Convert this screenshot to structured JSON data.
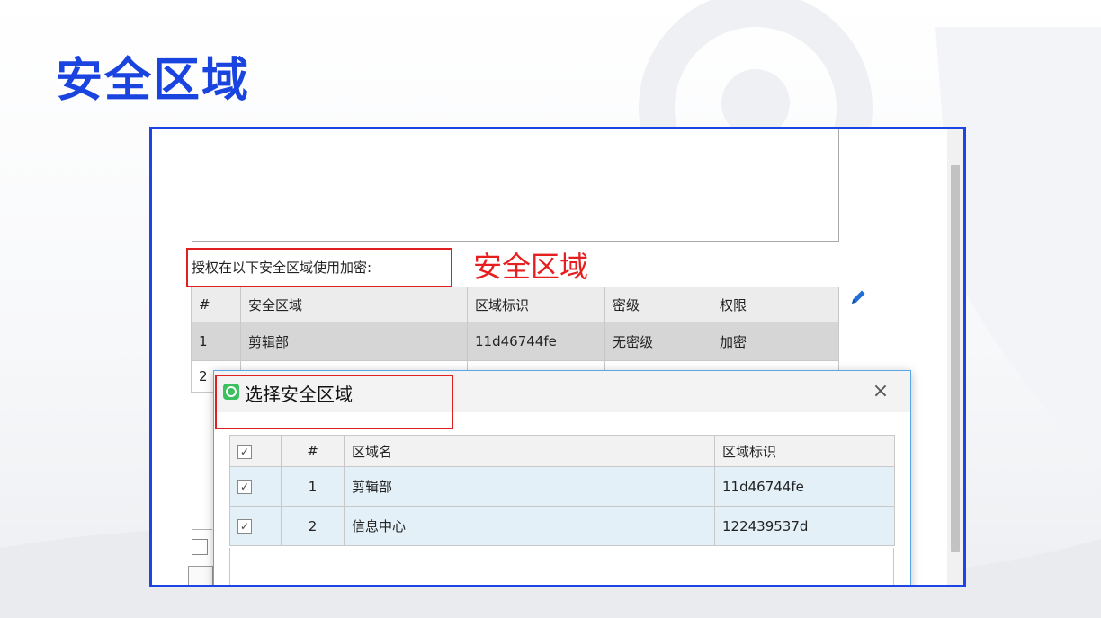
{
  "page": {
    "title": "安全区域"
  },
  "form": {
    "auth_label": "授权在以下安全区域使用加密:",
    "annotation": "安全区域",
    "columns": [
      "#",
      "安全区域",
      "区域标识",
      "密级",
      "权限"
    ],
    "rows": [
      {
        "num": "1",
        "zone": "剪辑部",
        "id": "11d46744fe",
        "level": "无密级",
        "perm": "加密"
      },
      {
        "num": "2"
      }
    ]
  },
  "dialog": {
    "title": "选择安全区域",
    "close": "×",
    "columns": [
      "✓",
      "#",
      "区域名",
      "区域标识"
    ],
    "rows": [
      {
        "check": "✓",
        "num": "1",
        "name": "剪辑部",
        "id": "11d46744fe"
      },
      {
        "check": "✓",
        "num": "2",
        "name": "信息中心",
        "id": "122439537d"
      }
    ]
  },
  "colors": {
    "title_blue": "#1a44e0",
    "frame_blue": "#1d45e6",
    "annotation_red": "#e61e1e",
    "selection_blue": "#e4f0f8"
  },
  "icons": {
    "edit": "pencil-icon",
    "dialog_app": "app-icon",
    "close": "close-icon"
  }
}
